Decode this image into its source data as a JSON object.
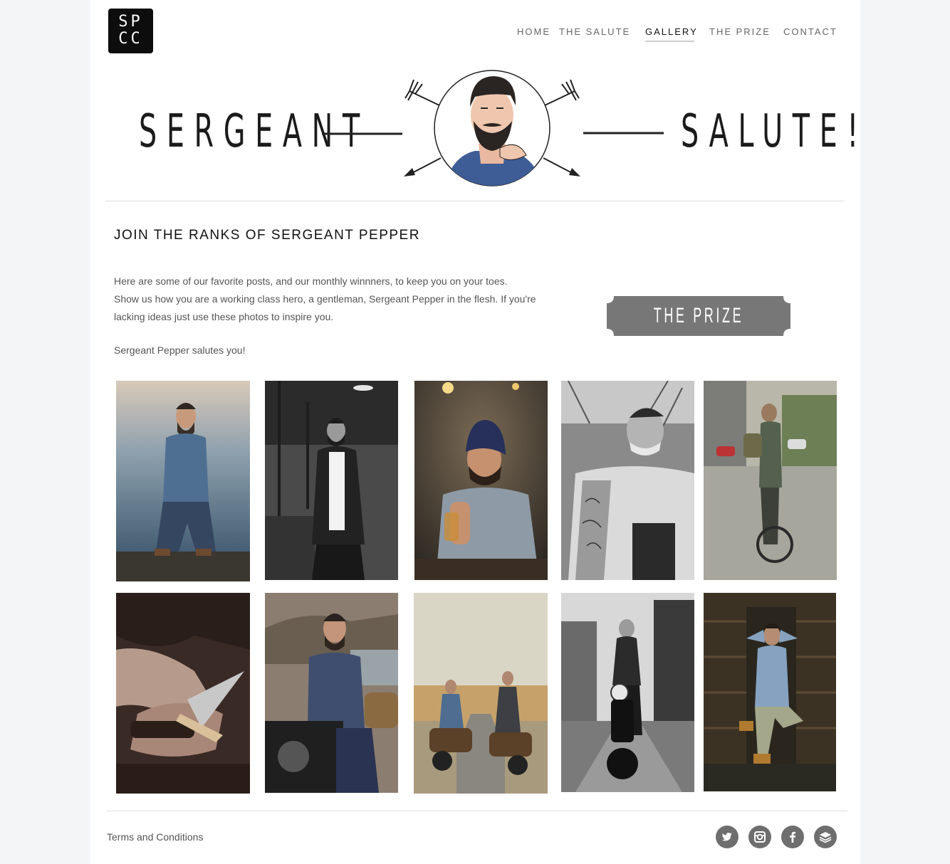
{
  "logo": {
    "line1": "SP",
    "line2": "CC"
  },
  "nav": {
    "items": [
      {
        "label": "HOME"
      },
      {
        "label": "THE SALUTE"
      },
      {
        "label": "GALLERY",
        "active": true
      },
      {
        "label": "THE PRIZE"
      },
      {
        "label": "CONTACT"
      }
    ]
  },
  "hero": {
    "left_word": "SERGEANT",
    "right_word": "SALUTE!"
  },
  "main": {
    "heading": "JOIN THE RANKS OF SERGEANT PEPPER",
    "intro_line1": "Here are some of our favorite posts, and our monthly winnners, to keep you on your toes.",
    "intro_line2": "Show us how you are a working class hero, a gentleman, Sergeant Pepper in the flesh. If you're",
    "intro_line3": "lacking ideas just use these photos to inspire you.",
    "salutes": "Sergeant Pepper salutes you!",
    "prize_button": "THE PRIZE"
  },
  "gallery": {
    "photos": [
      {
        "subject": "man-kneeling-by-sea"
      },
      {
        "subject": "man-in-cafe-bw"
      },
      {
        "subject": "man-in-beanie-with-beer"
      },
      {
        "subject": "man-shaving-bw"
      },
      {
        "subject": "man-with-bicycle-street"
      },
      {
        "subject": "hands-whittling-knife"
      },
      {
        "subject": "man-on-motorcycle-lake"
      },
      {
        "subject": "two-men-motorcycles-road"
      },
      {
        "subject": "man-on-motorcycle-city-bw"
      },
      {
        "subject": "man-sitting-wooden-wall"
      }
    ]
  },
  "footer": {
    "terms": "Terms and Conditions",
    "social": [
      {
        "icon": "twitter-icon"
      },
      {
        "icon": "instagram-icon"
      },
      {
        "icon": "facebook-icon"
      },
      {
        "icon": "layers-icon"
      }
    ]
  },
  "colors": {
    "prize_button": "#777777",
    "social_icon_bg": "#6e6e6e",
    "page_bg": "#f4f5f7"
  }
}
